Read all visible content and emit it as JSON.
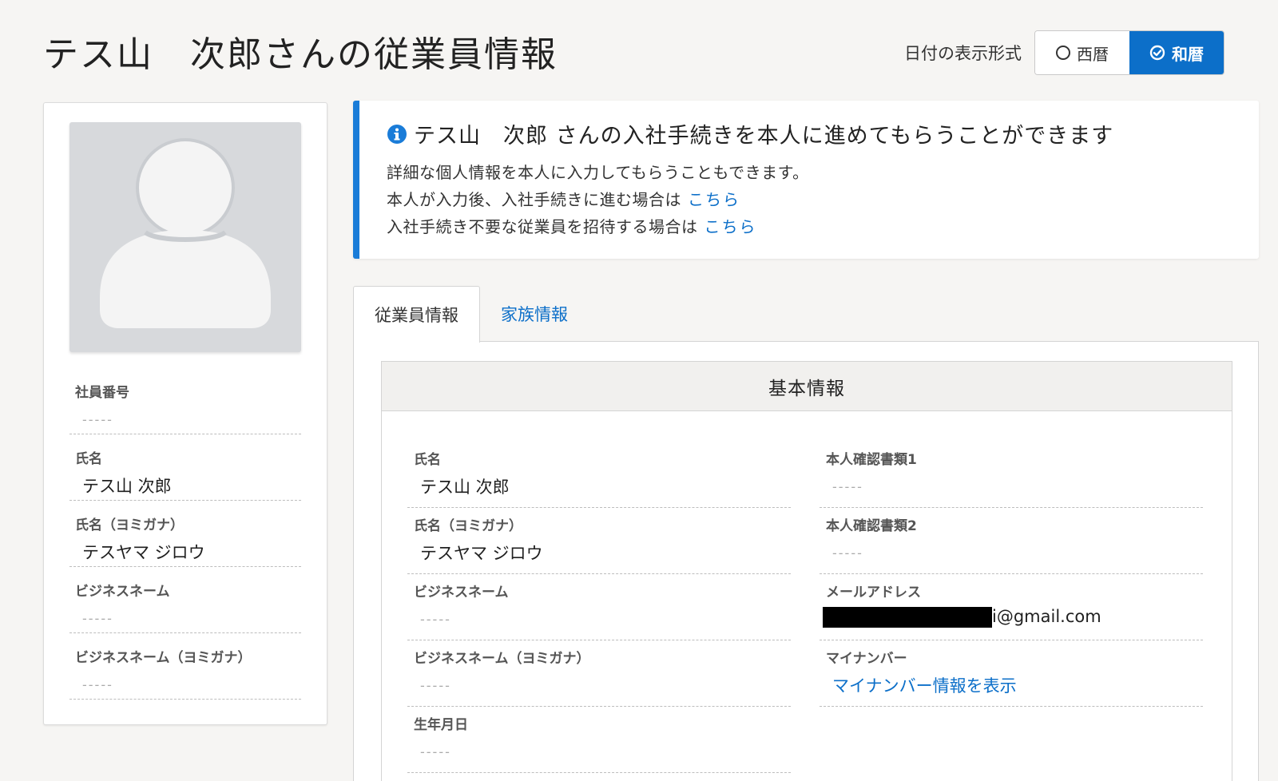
{
  "header": {
    "title": "テス山　次郎さんの従業員情報",
    "date_format_label": "日付の表示形式",
    "date_options": [
      {
        "label": "西暦",
        "selected": false
      },
      {
        "label": "和暦",
        "selected": true
      }
    ]
  },
  "colors": {
    "accent": "#0c6fc9",
    "banner_border": "#1a7cd8",
    "background": "#f6f5f3"
  },
  "profile": {
    "fields": [
      {
        "label": "社員番号",
        "value": "-----",
        "empty": true
      },
      {
        "label": "氏名",
        "value": "テス山 次郎",
        "empty": false
      },
      {
        "label": "氏名（ヨミガナ）",
        "value": "テスヤマ ジロウ",
        "empty": false
      },
      {
        "label": "ビジネスネーム",
        "value": "-----",
        "empty": true
      },
      {
        "label": "ビジネスネーム（ヨミガナ）",
        "value": "-----",
        "empty": true
      }
    ]
  },
  "banner": {
    "icon": "info-icon",
    "title": "テス山　次郎 さんの入社手続きを本人に進めてもらうことができます",
    "line1": "詳細な個人情報を本人に入力してもらうこともできます。",
    "line2": "本人が入力後、入社手続きに進む場合は",
    "line2_link": "こちら",
    "line3": "入社手続き不要な従業員を招待する場合は",
    "line3_link": "こちら"
  },
  "tabs": [
    {
      "label": "従業員情報",
      "active": true
    },
    {
      "label": "家族情報",
      "active": false
    }
  ],
  "section": {
    "title": "基本情報",
    "left_fields": [
      {
        "label": "氏名",
        "value": "テス山 次郎"
      },
      {
        "label": "氏名（ヨミガナ）",
        "value": "テスヤマ ジロウ"
      },
      {
        "label": "ビジネスネーム",
        "value": "-----"
      },
      {
        "label": "ビジネスネーム（ヨミガナ）",
        "value": "-----"
      },
      {
        "label": "生年月日",
        "value": "-----"
      }
    ],
    "right_fields": [
      {
        "label": "本人確認書類1",
        "value": "-----"
      },
      {
        "label": "本人確認書類2",
        "value": "-----"
      },
      {
        "label": "メールアドレス",
        "value": "i@gmail.com"
      },
      {
        "label": "マイナンバー",
        "value": "マイナンバー情報を表示"
      }
    ]
  }
}
